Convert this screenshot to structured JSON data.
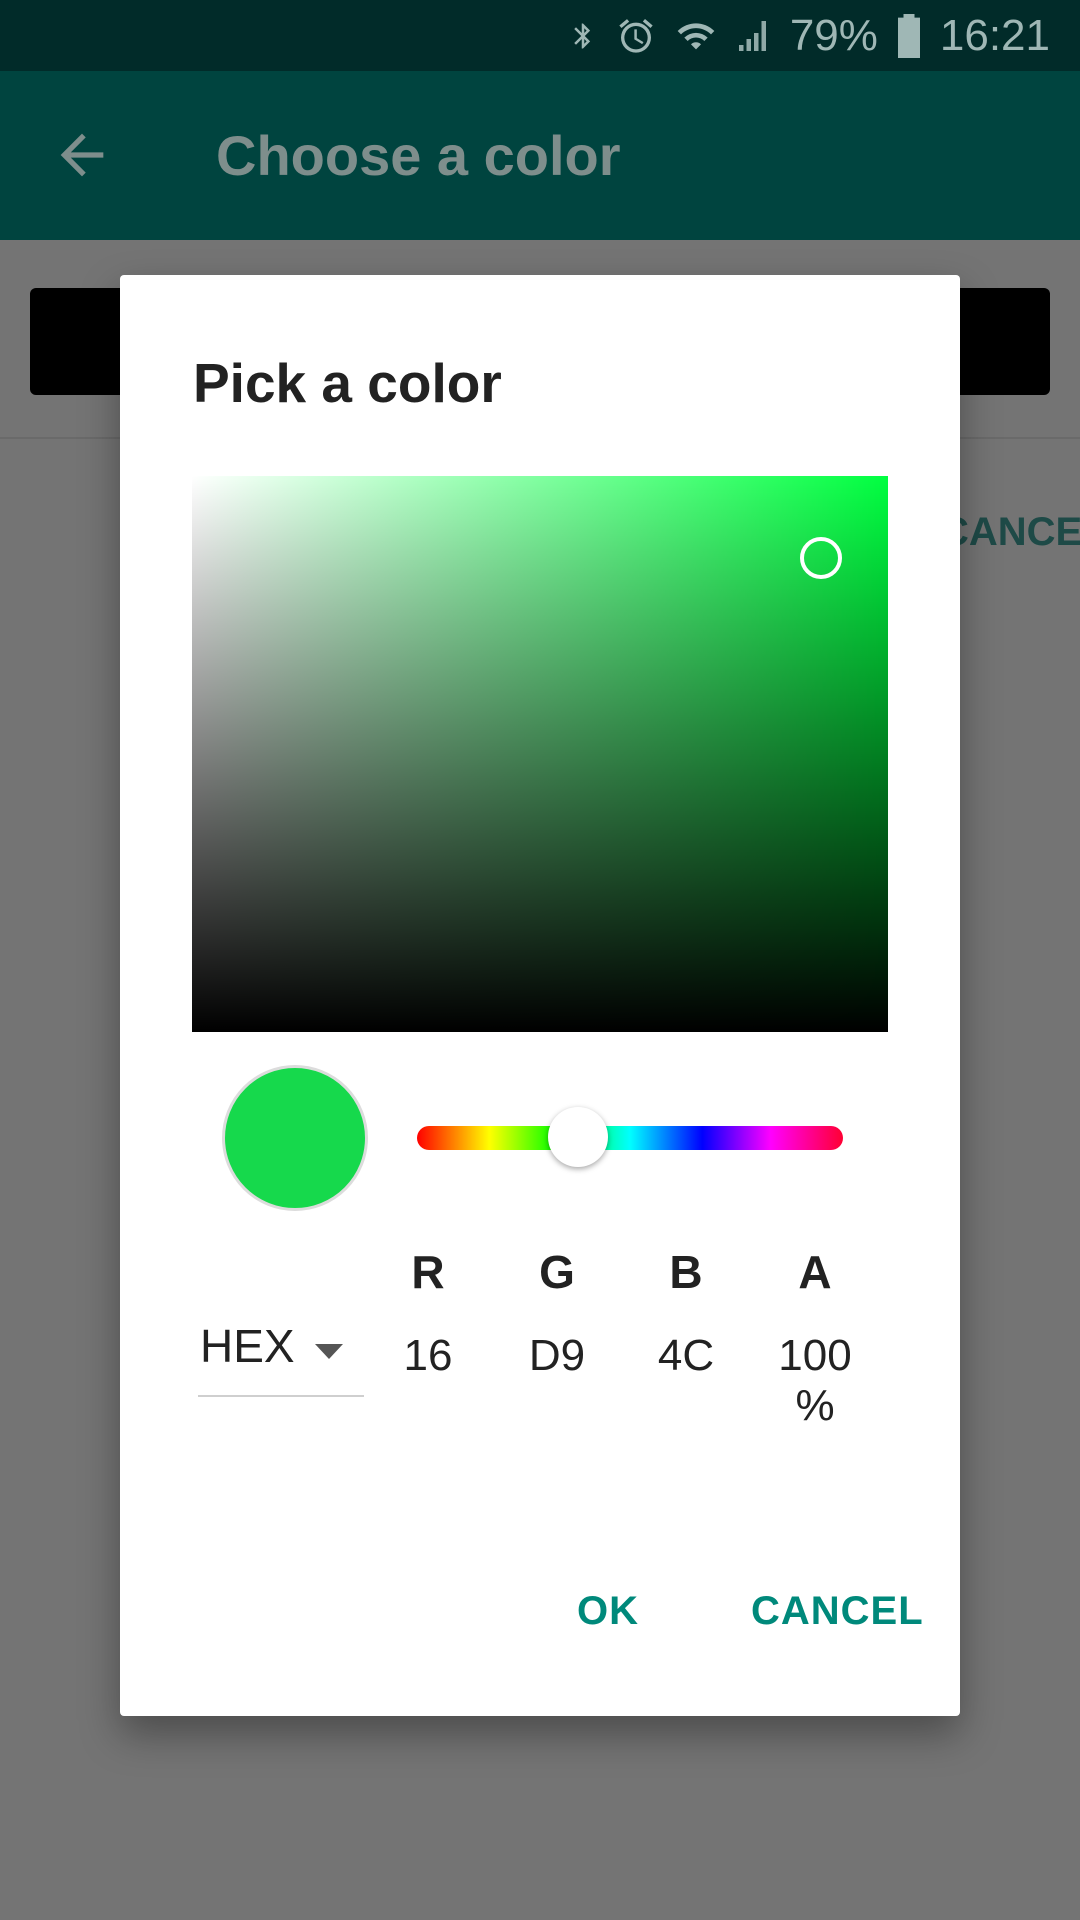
{
  "status_bar": {
    "battery_percent": "79%",
    "time": "16:21",
    "icons": [
      "bluetooth-icon",
      "alarm-icon",
      "wifi-icon",
      "signal-icon",
      "battery-icon"
    ]
  },
  "app_bar": {
    "title": "Choose a color",
    "back_icon": "arrow-back-icon"
  },
  "background": {
    "cancel_label": "CANCEL"
  },
  "dialog": {
    "title": "Pick a color",
    "selected_color": "#16D94C",
    "hue_color": "#00FF40",
    "mode": "HEX",
    "channels": [
      {
        "label": "R",
        "value": "16"
      },
      {
        "label": "G",
        "value": "D9"
      },
      {
        "label": "B",
        "value": "4C"
      },
      {
        "label": "A",
        "value": "100 %"
      }
    ],
    "ok_label": "OK",
    "cancel_label": "CANCEL",
    "accent_color": "#00897B"
  }
}
